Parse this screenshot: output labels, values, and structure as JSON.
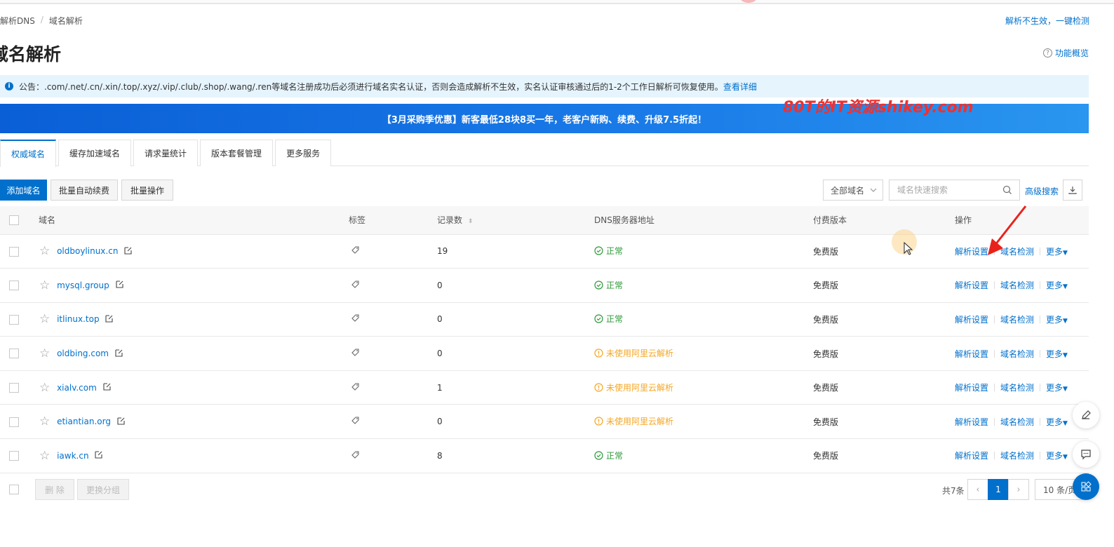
{
  "breadcrumb": [
    "云解析DNS",
    "域名解析"
  ],
  "top_right_link": "解析不生效，一键检测",
  "page_title": "域名解析",
  "overview_link": "功能概览",
  "notice": {
    "text": "公告：.com/.net/.cn/.xin/.top/.xyz/.vip/.club/.shop/.wang/.ren等域名注册成功后必须进行域名实名认证，否则会造成解析不生效，实名认证审核通过后的1-2个工作日解析可恢复使用。",
    "link": "查看详细"
  },
  "banner": "【3月采购季优惠】新客最低28块8买一年，老客户新购、续费、升级7.5折起！",
  "watermark": "80T的IT资源shikey.com",
  "tabs": [
    "权威域名",
    "缓存加速域名",
    "请求量统计",
    "版本套餐管理",
    "更多服务"
  ],
  "toolbar": {
    "add": "添加域名",
    "batch_renew": "批量自动续费",
    "batch_op": "批量操作",
    "filter": "全部域名",
    "search_placeholder": "域名快速搜索",
    "advanced": "高级搜索"
  },
  "table": {
    "headers": [
      "域名",
      "标签",
      "记录数",
      "DNS服务器地址",
      "付费版本",
      "操作"
    ],
    "rows": [
      {
        "domain": "oldboylinux.cn",
        "records": "19",
        "status": "正常",
        "status_type": "ok",
        "plan": "免费版"
      },
      {
        "domain": "mysql.group",
        "records": "0",
        "status": "正常",
        "status_type": "ok",
        "plan": "免费版"
      },
      {
        "domain": "itlinux.top",
        "records": "0",
        "status": "正常",
        "status_type": "ok",
        "plan": "免费版"
      },
      {
        "domain": "oldbing.com",
        "records": "0",
        "status": "未使用阿里云解析",
        "status_type": "warn",
        "plan": "免费版"
      },
      {
        "domain": "xialv.com",
        "records": "1",
        "status": "未使用阿里云解析",
        "status_type": "warn",
        "plan": "免费版"
      },
      {
        "domain": "etiantian.org",
        "records": "0",
        "status": "未使用阿里云解析",
        "status_type": "warn",
        "plan": "免费版"
      },
      {
        "domain": "iawk.cn",
        "records": "8",
        "status": "正常",
        "status_type": "ok",
        "plan": "免费版"
      }
    ],
    "ops": [
      "解析设置",
      "域名检测",
      "更多"
    ]
  },
  "footer": {
    "delete": "删 除",
    "change_group": "更换分组",
    "total": "共7条",
    "page": "1",
    "page_size": "10 条/页"
  },
  "colors": {
    "accent": "#0070cc",
    "ok": "#2e9a3a",
    "warn": "#f5a623",
    "watermark": "#f03030"
  }
}
